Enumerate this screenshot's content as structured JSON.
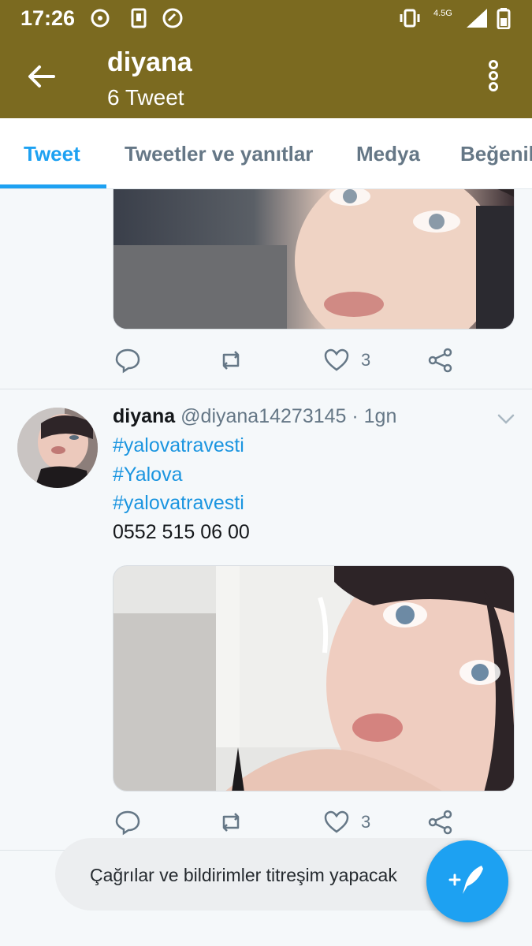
{
  "status_bar": {
    "time": "17:26",
    "network": "4.5G",
    "icons": [
      "cast-icon",
      "sim-icon",
      "call-icon",
      "vibrate-icon",
      "signal-icon",
      "battery-icon"
    ]
  },
  "header": {
    "title": "diyana",
    "subtitle": "6 Tweet"
  },
  "tabs": [
    {
      "label": "Tweet",
      "active": true
    },
    {
      "label": "Tweetler ve yanıtlar",
      "active": false
    },
    {
      "label": "Medya",
      "active": false
    },
    {
      "label": "Beğenil",
      "active": false
    }
  ],
  "tweets": [
    {
      "partial": true,
      "likes": "3"
    },
    {
      "name": "diyana",
      "handle": "@diyana14273145 · 1gn",
      "lines": [
        "#yalovatravesti",
        "#Yalova",
        "#yalovatravesti",
        "0552 515 06 00"
      ],
      "likes": "3"
    }
  ],
  "toast": {
    "message": "Çağrılar ve bildirimler titreşim yapacak"
  },
  "colors": {
    "app_bar": "#7b6a20",
    "accent": "#1da1f2",
    "hashtag": "#1b95e0",
    "muted": "#657786"
  }
}
